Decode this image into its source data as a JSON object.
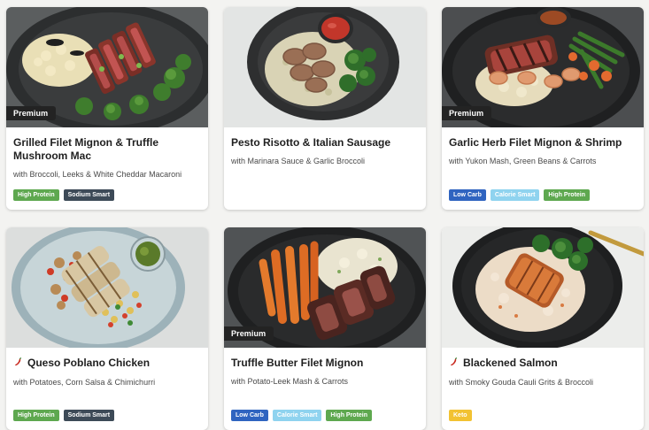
{
  "meals": [
    {
      "title": "Grilled Filet Mignon & Truffle Mushroom Mac",
      "subtitle": "with Broccoli, Leeks & White Cheddar Macaroni",
      "premium": "Premium",
      "spicy": false,
      "badges": [
        {
          "label": "High Protein",
          "bg": "#5ea84f",
          "fg": "#ffffff"
        },
        {
          "label": "Sodium Smart",
          "bg": "#3d4a57",
          "fg": "#ffffff"
        }
      ]
    },
    {
      "title": "Pesto Risotto & Italian Sausage",
      "subtitle": "with Marinara Sauce & Garlic Broccoli",
      "premium": "",
      "spicy": false,
      "badges": []
    },
    {
      "title": "Garlic Herb Filet Mignon & Shrimp",
      "subtitle": "with Yukon Mash, Green Beans & Carrots",
      "premium": "Premium",
      "spicy": false,
      "badges": [
        {
          "label": "Low Carb",
          "bg": "#2f64c0",
          "fg": "#ffffff"
        },
        {
          "label": "Calorie Smart",
          "bg": "#8fd3ef",
          "fg": "#ffffff"
        },
        {
          "label": "High Protein",
          "bg": "#5ea84f",
          "fg": "#ffffff"
        }
      ]
    },
    {
      "title": "Queso Poblano Chicken",
      "subtitle": "with Potatoes, Corn Salsa & Chimichurri",
      "premium": "",
      "spicy": true,
      "badges": [
        {
          "label": "High Protein",
          "bg": "#5ea84f",
          "fg": "#ffffff"
        },
        {
          "label": "Sodium Smart",
          "bg": "#3d4a57",
          "fg": "#ffffff"
        }
      ]
    },
    {
      "title": "Truffle Butter Filet Mignon",
      "subtitle": "with Potato-Leek Mash & Carrots",
      "premium": "Premium",
      "spicy": false,
      "badges": [
        {
          "label": "Low Carb",
          "bg": "#2f64c0",
          "fg": "#ffffff"
        },
        {
          "label": "Calorie Smart",
          "bg": "#8fd3ef",
          "fg": "#ffffff"
        },
        {
          "label": "High Protein",
          "bg": "#5ea84f",
          "fg": "#ffffff"
        }
      ]
    },
    {
      "title": "Blackened Salmon",
      "subtitle": "with Smoky Gouda Cauli Grits & Broccoli",
      "premium": "",
      "spicy": true,
      "badges": [
        {
          "label": "Keto",
          "bg": "#f2c232",
          "fg": "#ffffff"
        }
      ]
    }
  ],
  "icons": {
    "spicy": "chili-pepper-icon"
  }
}
